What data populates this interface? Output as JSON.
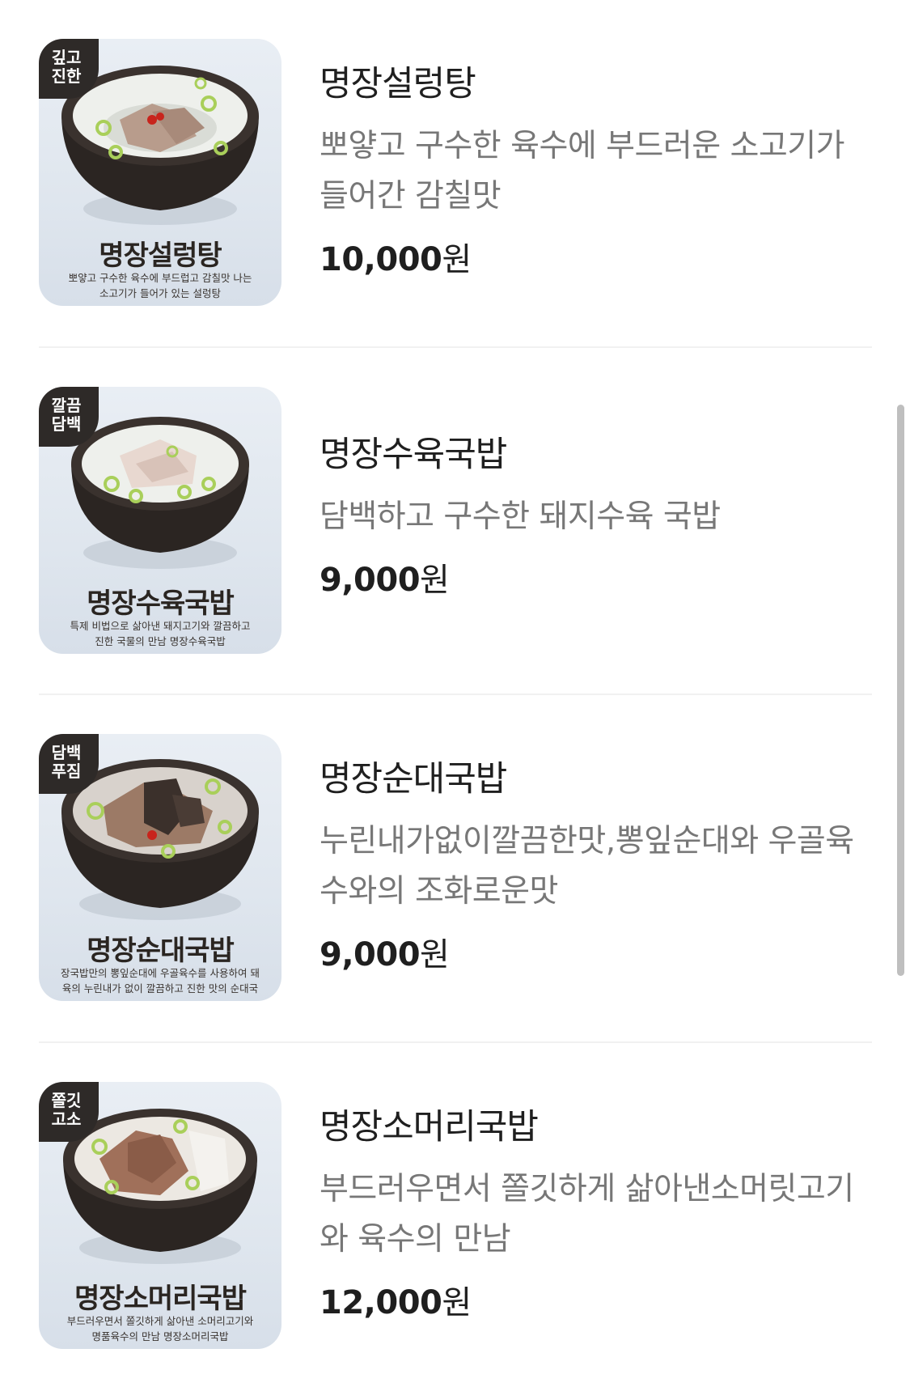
{
  "menu": {
    "items": [
      {
        "name": "명장설렁탕",
        "description": "뽀얗고 구수한 육수에 부드러운 소고기가 들어간 감칠맛",
        "price": "10,000",
        "currency": "원",
        "badge": [
          "깊고",
          "진한"
        ],
        "image_title": "명장설렁탕",
        "image_caption": [
          "뽀얗고 구수한 육수에 부드럽고 감칠맛 나는",
          "소고기가 들어가 있는 설렁탕"
        ]
      },
      {
        "name": "명장수육국밥",
        "description": "담백하고 구수한 돼지수육 국밥",
        "price": "9,000",
        "currency": "원",
        "badge": [
          "깔끔",
          "담백"
        ],
        "image_title": "명장수육국밥",
        "image_caption": [
          "특제 비법으로 삶아낸 돼지고기와 깔끔하고",
          "진한 국물의 만남 명장수육국밥"
        ]
      },
      {
        "name": "명장순대국밥",
        "description": "누린내가없이깔끔한맛,뽕잎순대와 우골육수와의 조화로운맛",
        "price": "9,000",
        "currency": "원",
        "badge": [
          "담백",
          "푸짐"
        ],
        "image_title": "명장순대국밥",
        "image_caption": [
          "장국밥만의 뽕잎순대에 우골육수를 사용하여 돼",
          "육의 누린내가 없이 깔끔하고 진한 맛의 순대국"
        ]
      },
      {
        "name": "명장소머리국밥",
        "description": "부드러우면서 쫄깃하게 삶아낸소머릿고기와 육수의 만남",
        "price": "12,000",
        "currency": "원",
        "badge": [
          "쫄깃",
          "고소"
        ],
        "image_title": "명장소머리국밥",
        "image_caption": [
          "부드러우면서 쫄깃하게 삶아낸 소머리고기와",
          "명품육수의 만남 명장소머리국밥"
        ]
      }
    ]
  }
}
